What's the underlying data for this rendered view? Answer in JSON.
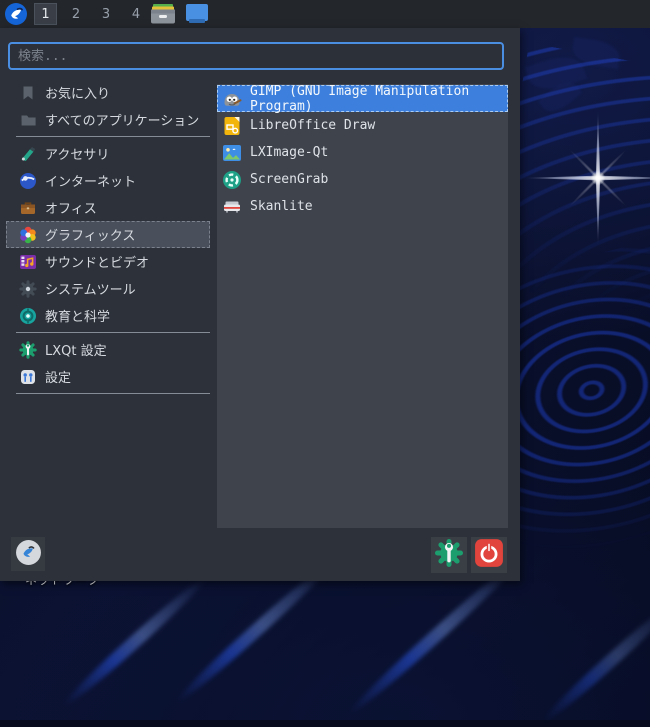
{
  "desktop": {
    "wallpaper_label": "ネットワーク"
  },
  "panel": {
    "logo_icon": "lxqt-logo-icon",
    "workspaces": [
      "1",
      "2",
      "3",
      "4"
    ],
    "active_workspace": "1",
    "tray_icons": [
      "file-manager-icon",
      "desktop-icon"
    ]
  },
  "menu": {
    "search": {
      "placeholder": "検索...",
      "value": ""
    },
    "categories": [
      {
        "label": "お気に入り",
        "icon": "bookmark-icon"
      },
      {
        "label": "すべてのアプリケーション",
        "icon": "folder-icon"
      },
      {
        "separator": true
      },
      {
        "label": "アクセサリ",
        "icon": "accessories-icon"
      },
      {
        "label": "インターネット",
        "icon": "internet-icon"
      },
      {
        "label": "オフィス",
        "icon": "office-icon"
      },
      {
        "label": "グラフィックス",
        "icon": "graphics-icon",
        "selected": true
      },
      {
        "label": "サウンドとビデオ",
        "icon": "sound-video-icon"
      },
      {
        "label": "システムツール",
        "icon": "system-tools-icon"
      },
      {
        "label": "教育と科学",
        "icon": "education-icon"
      },
      {
        "separator": true
      },
      {
        "label": "LXQt 設定",
        "icon": "lxqt-settings-icon"
      },
      {
        "label": "設定",
        "icon": "preferences-icon"
      },
      {
        "separator": true
      }
    ],
    "apps": [
      {
        "label": "GIMP (GNU Image Manipulation Program)",
        "icon": "gimp-icon",
        "selected": true
      },
      {
        "label": "LibreOffice Draw",
        "icon": "libreoffice-draw-icon"
      },
      {
        "label": "LXImage-Qt",
        "icon": "lximage-qt-icon"
      },
      {
        "label": "ScreenGrab",
        "icon": "screengrab-icon"
      },
      {
        "label": "Skanlite",
        "icon": "skanlite-icon"
      }
    ],
    "footer": {
      "menu_logo_icon": "lxqt-logo-icon",
      "leave_icon": "lxqt-leave-icon",
      "power_icon": "power-icon"
    }
  },
  "colors": {
    "accent_blue": "#3c7fdc",
    "search_border": "#4a8ee2",
    "selection_gray": "#4a505b",
    "power_red": "#e0443c",
    "leave_green": "#1d9e6e",
    "panel_bg": "#23262b",
    "menu_bg": "#2d3139",
    "app_panel_bg": "#3e434c",
    "wallpaper_navy": "#0a1233"
  }
}
